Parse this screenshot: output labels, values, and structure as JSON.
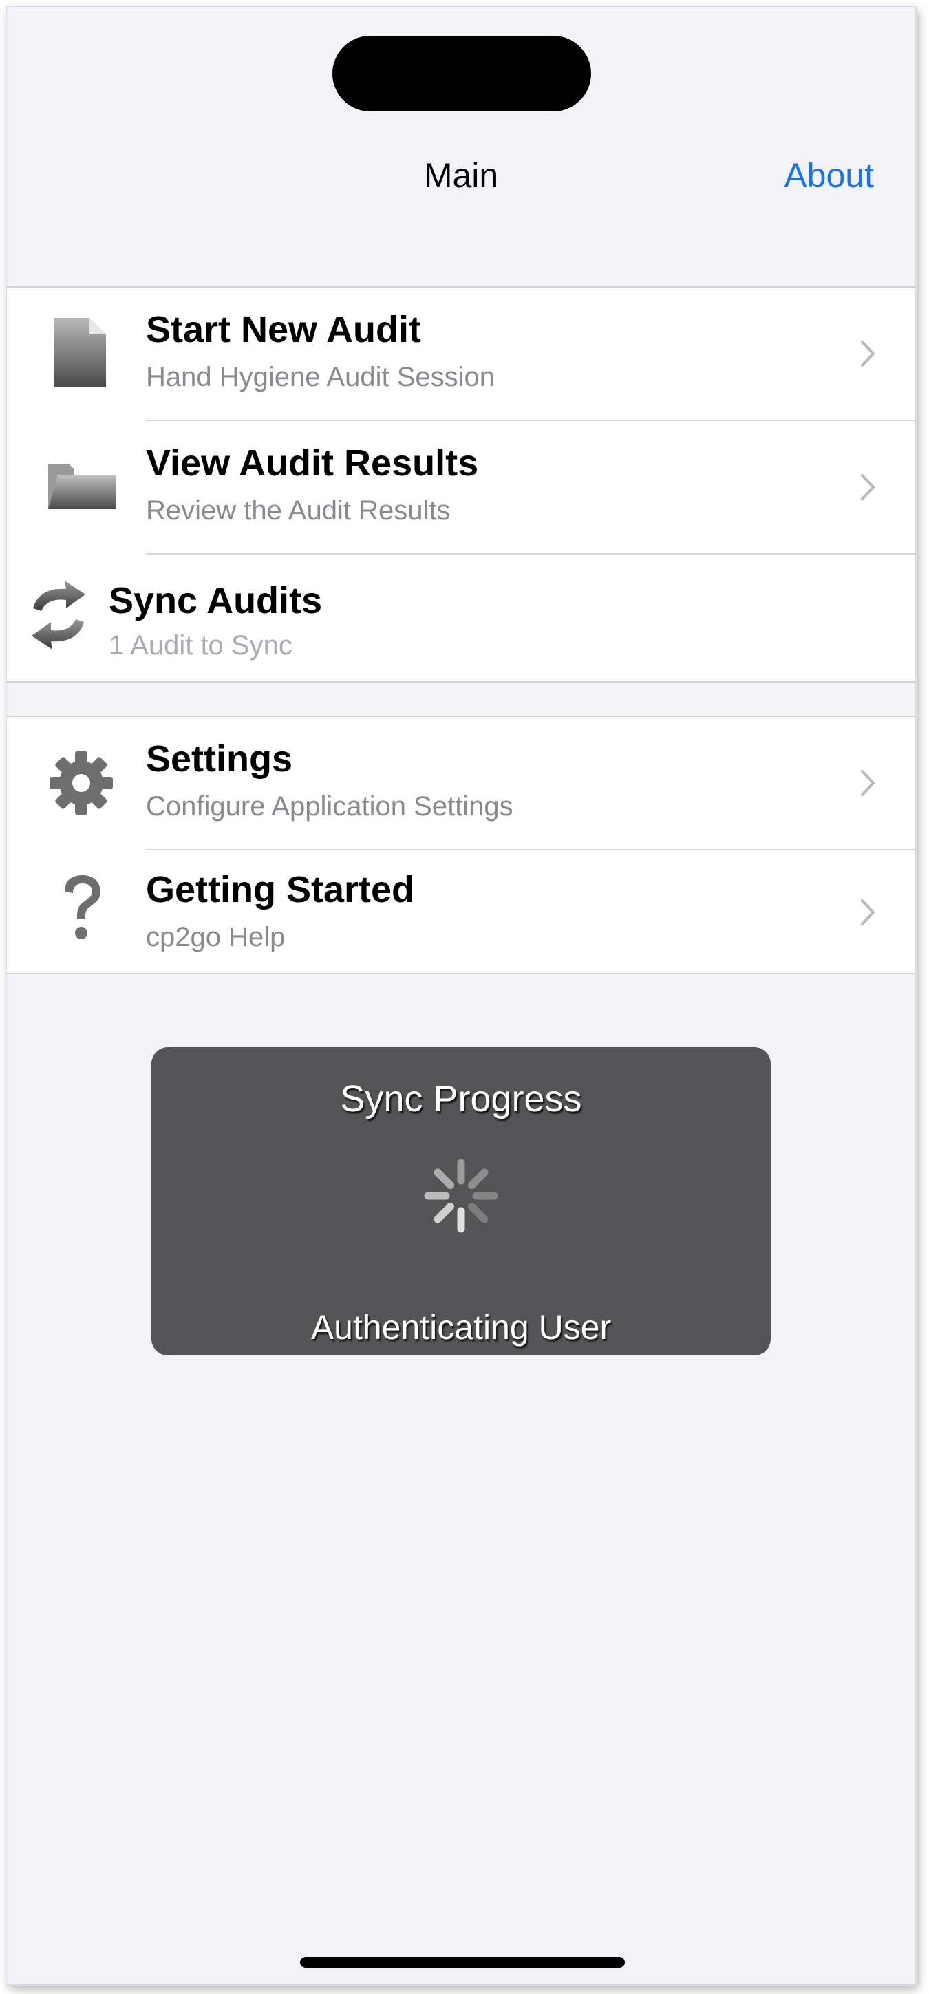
{
  "nav": {
    "title": "Main",
    "about_label": "About"
  },
  "menu_group_1": [
    {
      "title": "Start New Audit",
      "subtitle": "Hand Hygiene Audit Session",
      "icon": "document-icon"
    },
    {
      "title": "View Audit Results",
      "subtitle": "Review the Audit Results",
      "icon": "folder-icon"
    },
    {
      "title": "Sync Audits",
      "subtitle": "1 Audit to Sync",
      "icon": "sync-icon"
    }
  ],
  "menu_group_2": [
    {
      "title": "Settings",
      "subtitle": "Configure Application Settings",
      "icon": "gear-icon"
    },
    {
      "title": "Getting Started",
      "subtitle": "cp2go Help",
      "icon": "question-icon"
    }
  ],
  "sync_hud": {
    "title": "Sync Progress",
    "status": "Authenticating User"
  },
  "colors": {
    "accent": "#1a73e8",
    "background": "#f2f2f7",
    "hud": "#545456"
  }
}
